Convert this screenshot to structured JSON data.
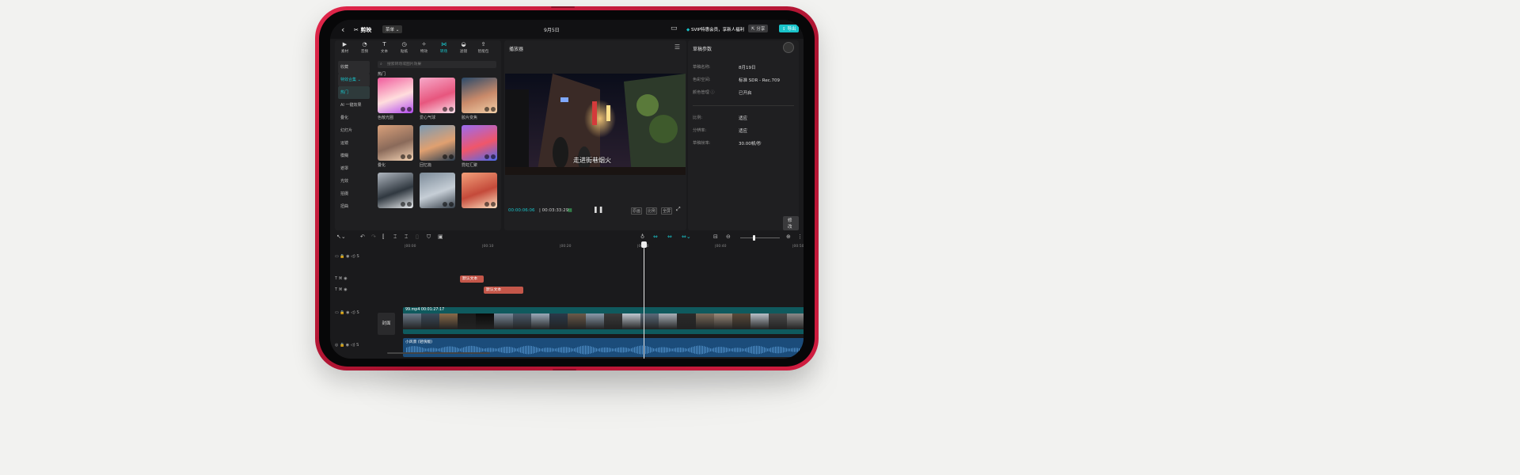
{
  "topbar": {
    "app_name": "剪映",
    "menu_label": "菜单",
    "date": "9月5日",
    "vip_text": "SVIP特惠会员，享新人福利",
    "share_label": "分享",
    "export_label": "导出"
  },
  "toolbar": {
    "tools": [
      {
        "icon": "▶",
        "label": "素材"
      },
      {
        "icon": "◔",
        "label": "音频"
      },
      {
        "icon": "T",
        "label": "文本"
      },
      {
        "icon": "◷",
        "label": "贴纸"
      },
      {
        "icon": "✧",
        "label": "特效"
      },
      {
        "icon": "⋈",
        "label": "转场"
      },
      {
        "icon": "◒",
        "label": "滤镜"
      },
      {
        "icon": "⇪",
        "label": "智能包"
      }
    ]
  },
  "categories": [
    "收藏",
    "特效合集",
    "热门",
    "AI 一键效果",
    "叠化",
    "幻灯片",
    "运镜",
    "模糊",
    "遮罩",
    "光效",
    "拍摄",
    "扭曲"
  ],
  "search": {
    "placeholder": "搜索转场或图片效果"
  },
  "section_title": "热门",
  "effects": [
    {
      "label": "色散光圈"
    },
    {
      "label": "爱心气球"
    },
    {
      "label": "胶片变焦"
    },
    {
      "label": "叠化"
    },
    {
      "label": "回忆篇"
    },
    {
      "label": "霓虹汇聚"
    },
    {
      "label": ""
    },
    {
      "label": ""
    },
    {
      "label": ""
    }
  ],
  "player": {
    "title": "播放器",
    "subtitle": "走进街巷烟火",
    "current_time": "00:00:06:06",
    "total_time": "00:03:33:29",
    "controls": [
      "原画",
      "比例",
      "全屏"
    ]
  },
  "properties": {
    "title": "草稿参数",
    "rows": [
      {
        "label": "草稿名称:",
        "value": "8月19日"
      },
      {
        "label": "色彩空间:",
        "value": "标准 SDR - Rec.709"
      },
      {
        "label": "颜色管理 ⓘ",
        "value": "已开启"
      },
      {
        "label": "比例:",
        "value": "适应"
      },
      {
        "label": "分辨率:",
        "value": "适应"
      },
      {
        "label": "草稿帧率:",
        "value": "30.00帧/秒"
      }
    ],
    "modify_label": "修改"
  },
  "ruler": [
    "00:00",
    "00:10",
    "00:20",
    "00:30",
    "00:40",
    "00:50"
  ],
  "tracks": {
    "text_clip_1": "默认文本",
    "text_clip_2": "默认文本",
    "video_clip_label": "99.mp4  00:01:27:17",
    "cover_label": "封面",
    "audio_clip_label": "小风景 (轻快版)"
  },
  "colors": {
    "accent": "#19c3c9",
    "device_red": "#d11d40",
    "text_clip": "#c4574a",
    "audio_clip": "#1b4c7a"
  }
}
